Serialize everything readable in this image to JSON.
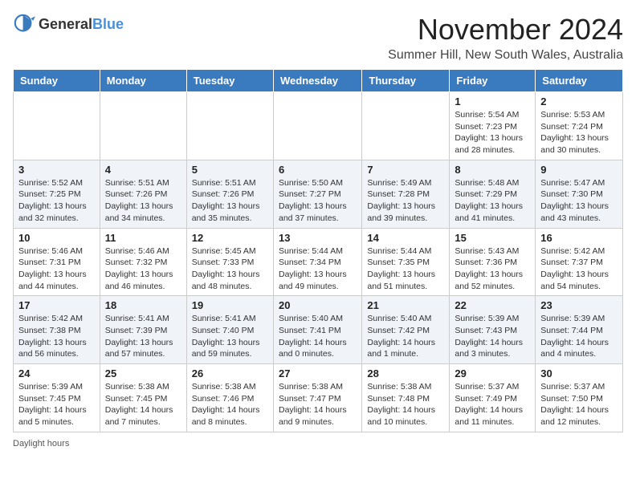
{
  "header": {
    "logo_general": "General",
    "logo_blue": "Blue",
    "month_title": "November 2024",
    "location": "Summer Hill, New South Wales, Australia"
  },
  "days_of_week": [
    "Sunday",
    "Monday",
    "Tuesday",
    "Wednesday",
    "Thursday",
    "Friday",
    "Saturday"
  ],
  "weeks": [
    [
      {
        "day": "",
        "info": ""
      },
      {
        "day": "",
        "info": ""
      },
      {
        "day": "",
        "info": ""
      },
      {
        "day": "",
        "info": ""
      },
      {
        "day": "",
        "info": ""
      },
      {
        "day": "1",
        "info": "Sunrise: 5:54 AM\nSunset: 7:23 PM\nDaylight: 13 hours and 28 minutes."
      },
      {
        "day": "2",
        "info": "Sunrise: 5:53 AM\nSunset: 7:24 PM\nDaylight: 13 hours and 30 minutes."
      }
    ],
    [
      {
        "day": "3",
        "info": "Sunrise: 5:52 AM\nSunset: 7:25 PM\nDaylight: 13 hours and 32 minutes."
      },
      {
        "day": "4",
        "info": "Sunrise: 5:51 AM\nSunset: 7:26 PM\nDaylight: 13 hours and 34 minutes."
      },
      {
        "day": "5",
        "info": "Sunrise: 5:51 AM\nSunset: 7:26 PM\nDaylight: 13 hours and 35 minutes."
      },
      {
        "day": "6",
        "info": "Sunrise: 5:50 AM\nSunset: 7:27 PM\nDaylight: 13 hours and 37 minutes."
      },
      {
        "day": "7",
        "info": "Sunrise: 5:49 AM\nSunset: 7:28 PM\nDaylight: 13 hours and 39 minutes."
      },
      {
        "day": "8",
        "info": "Sunrise: 5:48 AM\nSunset: 7:29 PM\nDaylight: 13 hours and 41 minutes."
      },
      {
        "day": "9",
        "info": "Sunrise: 5:47 AM\nSunset: 7:30 PM\nDaylight: 13 hours and 43 minutes."
      }
    ],
    [
      {
        "day": "10",
        "info": "Sunrise: 5:46 AM\nSunset: 7:31 PM\nDaylight: 13 hours and 44 minutes."
      },
      {
        "day": "11",
        "info": "Sunrise: 5:46 AM\nSunset: 7:32 PM\nDaylight: 13 hours and 46 minutes."
      },
      {
        "day": "12",
        "info": "Sunrise: 5:45 AM\nSunset: 7:33 PM\nDaylight: 13 hours and 48 minutes."
      },
      {
        "day": "13",
        "info": "Sunrise: 5:44 AM\nSunset: 7:34 PM\nDaylight: 13 hours and 49 minutes."
      },
      {
        "day": "14",
        "info": "Sunrise: 5:44 AM\nSunset: 7:35 PM\nDaylight: 13 hours and 51 minutes."
      },
      {
        "day": "15",
        "info": "Sunrise: 5:43 AM\nSunset: 7:36 PM\nDaylight: 13 hours and 52 minutes."
      },
      {
        "day": "16",
        "info": "Sunrise: 5:42 AM\nSunset: 7:37 PM\nDaylight: 13 hours and 54 minutes."
      }
    ],
    [
      {
        "day": "17",
        "info": "Sunrise: 5:42 AM\nSunset: 7:38 PM\nDaylight: 13 hours and 56 minutes."
      },
      {
        "day": "18",
        "info": "Sunrise: 5:41 AM\nSunset: 7:39 PM\nDaylight: 13 hours and 57 minutes."
      },
      {
        "day": "19",
        "info": "Sunrise: 5:41 AM\nSunset: 7:40 PM\nDaylight: 13 hours and 59 minutes."
      },
      {
        "day": "20",
        "info": "Sunrise: 5:40 AM\nSunset: 7:41 PM\nDaylight: 14 hours and 0 minutes."
      },
      {
        "day": "21",
        "info": "Sunrise: 5:40 AM\nSunset: 7:42 PM\nDaylight: 14 hours and 1 minute."
      },
      {
        "day": "22",
        "info": "Sunrise: 5:39 AM\nSunset: 7:43 PM\nDaylight: 14 hours and 3 minutes."
      },
      {
        "day": "23",
        "info": "Sunrise: 5:39 AM\nSunset: 7:44 PM\nDaylight: 14 hours and 4 minutes."
      }
    ],
    [
      {
        "day": "24",
        "info": "Sunrise: 5:39 AM\nSunset: 7:45 PM\nDaylight: 14 hours and 5 minutes."
      },
      {
        "day": "25",
        "info": "Sunrise: 5:38 AM\nSunset: 7:45 PM\nDaylight: 14 hours and 7 minutes."
      },
      {
        "day": "26",
        "info": "Sunrise: 5:38 AM\nSunset: 7:46 PM\nDaylight: 14 hours and 8 minutes."
      },
      {
        "day": "27",
        "info": "Sunrise: 5:38 AM\nSunset: 7:47 PM\nDaylight: 14 hours and 9 minutes."
      },
      {
        "day": "28",
        "info": "Sunrise: 5:38 AM\nSunset: 7:48 PM\nDaylight: 14 hours and 10 minutes."
      },
      {
        "day": "29",
        "info": "Sunrise: 5:37 AM\nSunset: 7:49 PM\nDaylight: 14 hours and 11 minutes."
      },
      {
        "day": "30",
        "info": "Sunrise: 5:37 AM\nSunset: 7:50 PM\nDaylight: 14 hours and 12 minutes."
      }
    ]
  ],
  "footer": {
    "note": "Daylight hours"
  },
  "colors": {
    "header_bg": "#3a7abf",
    "header_text": "#ffffff",
    "accent": "#4a90d9"
  }
}
